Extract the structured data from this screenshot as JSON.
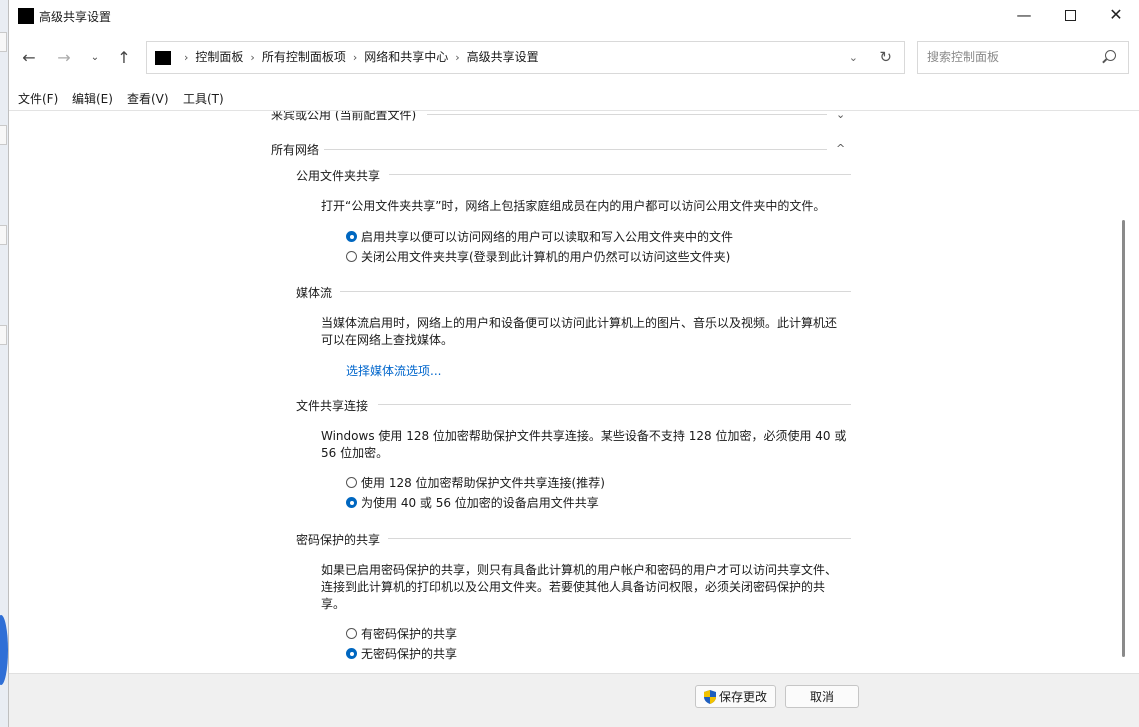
{
  "window": {
    "title": "高级共享设置",
    "controls": {
      "minimize": "—",
      "maximize": "",
      "close": "✕"
    }
  },
  "nav": {
    "back": "←",
    "forward": "→",
    "recent": "⌄",
    "up": "↑",
    "breadcrumbs": [
      "控制面板",
      "所有控制面板项",
      "网络和共享中心",
      "高级共享设置"
    ],
    "separator": "›",
    "dropdown": "⌄",
    "refresh": "↻"
  },
  "search": {
    "placeholder": "搜索控制面板"
  },
  "menu": [
    "文件(F)",
    "编辑(E)",
    "查看(V)",
    "工具(T)"
  ],
  "content": {
    "prev_section": {
      "title": "来宾或公用 (当前配置文件)",
      "chevron": "⌄"
    },
    "all_networks": {
      "title": "所有网络",
      "chevron": "^"
    },
    "public_folder": {
      "title": "公用文件夹共享",
      "description": "打开“公用文件夹共享”时，网络上包括家庭组成员在内的用户都可以访问公用文件夹中的文件。",
      "options": [
        {
          "label": "启用共享以便可以访问网络的用户可以读取和写入公用文件夹中的文件",
          "selected": true
        },
        {
          "label": "关闭公用文件夹共享(登录到此计算机的用户仍然可以访问这些文件夹)",
          "selected": false
        }
      ]
    },
    "media": {
      "title": "媒体流",
      "description_line1": "当媒体流启用时，网络上的用户和设备便可以访问此计算机上的图片、音乐以及视频。此计算机还",
      "description_line2": "可以在网络上查找媒体。",
      "link": "选择媒体流选项..."
    },
    "file_sharing": {
      "title": "文件共享连接",
      "description_line1": "Windows 使用 128 位加密帮助保护文件共享连接。某些设备不支持 128 位加密，必须使用 40 或",
      "description_line2": "56 位加密。",
      "options": [
        {
          "label": "使用 128 位加密帮助保护文件共享连接(推荐)",
          "selected": false
        },
        {
          "label": "为使用 40 或 56 位加密的设备启用文件共享",
          "selected": true
        }
      ]
    },
    "password": {
      "title": "密码保护的共享",
      "description_line1": "如果已启用密码保护的共享，则只有具备此计算机的用户帐户和密码的用户才可以访问共享文件、",
      "description_line2": "连接到此计算机的打印机以及公用文件夹。若要使其他人具备访问权限，必须关闭密码保护的共",
      "description_line3": "享。",
      "options": [
        {
          "label": "有密码保护的共享",
          "selected": false
        },
        {
          "label": "无密码保护的共享",
          "selected": true
        }
      ]
    }
  },
  "footer": {
    "save": "保存更改",
    "cancel": "取消"
  },
  "icons": {
    "app": "control-panel-icon",
    "shield": "uac-shield-icon"
  },
  "colors": {
    "accent": "#0067c0",
    "link": "#0066cc",
    "footer_bg": "#f0f0f0"
  }
}
